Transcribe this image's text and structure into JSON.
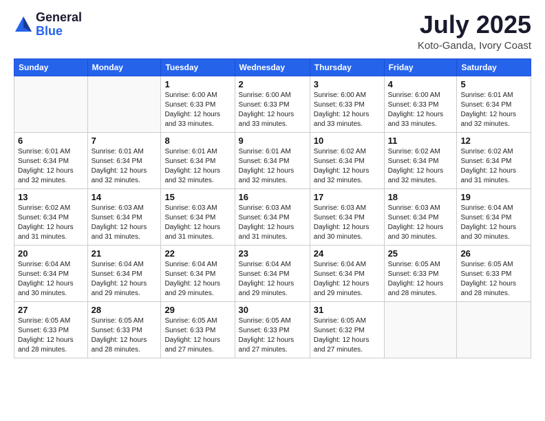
{
  "logo": {
    "general": "General",
    "blue": "Blue"
  },
  "title": "July 2025",
  "location": "Koto-Ganda, Ivory Coast",
  "days_of_week": [
    "Sunday",
    "Monday",
    "Tuesday",
    "Wednesday",
    "Thursday",
    "Friday",
    "Saturday"
  ],
  "weeks": [
    [
      {
        "num": "",
        "info": ""
      },
      {
        "num": "",
        "info": ""
      },
      {
        "num": "1",
        "info": "Sunrise: 6:00 AM\nSunset: 6:33 PM\nDaylight: 12 hours\nand 33 minutes."
      },
      {
        "num": "2",
        "info": "Sunrise: 6:00 AM\nSunset: 6:33 PM\nDaylight: 12 hours\nand 33 minutes."
      },
      {
        "num": "3",
        "info": "Sunrise: 6:00 AM\nSunset: 6:33 PM\nDaylight: 12 hours\nand 33 minutes."
      },
      {
        "num": "4",
        "info": "Sunrise: 6:00 AM\nSunset: 6:33 PM\nDaylight: 12 hours\nand 33 minutes."
      },
      {
        "num": "5",
        "info": "Sunrise: 6:01 AM\nSunset: 6:34 PM\nDaylight: 12 hours\nand 32 minutes."
      }
    ],
    [
      {
        "num": "6",
        "info": "Sunrise: 6:01 AM\nSunset: 6:34 PM\nDaylight: 12 hours\nand 32 minutes."
      },
      {
        "num": "7",
        "info": "Sunrise: 6:01 AM\nSunset: 6:34 PM\nDaylight: 12 hours\nand 32 minutes."
      },
      {
        "num": "8",
        "info": "Sunrise: 6:01 AM\nSunset: 6:34 PM\nDaylight: 12 hours\nand 32 minutes."
      },
      {
        "num": "9",
        "info": "Sunrise: 6:01 AM\nSunset: 6:34 PM\nDaylight: 12 hours\nand 32 minutes."
      },
      {
        "num": "10",
        "info": "Sunrise: 6:02 AM\nSunset: 6:34 PM\nDaylight: 12 hours\nand 32 minutes."
      },
      {
        "num": "11",
        "info": "Sunrise: 6:02 AM\nSunset: 6:34 PM\nDaylight: 12 hours\nand 32 minutes."
      },
      {
        "num": "12",
        "info": "Sunrise: 6:02 AM\nSunset: 6:34 PM\nDaylight: 12 hours\nand 31 minutes."
      }
    ],
    [
      {
        "num": "13",
        "info": "Sunrise: 6:02 AM\nSunset: 6:34 PM\nDaylight: 12 hours\nand 31 minutes."
      },
      {
        "num": "14",
        "info": "Sunrise: 6:03 AM\nSunset: 6:34 PM\nDaylight: 12 hours\nand 31 minutes."
      },
      {
        "num": "15",
        "info": "Sunrise: 6:03 AM\nSunset: 6:34 PM\nDaylight: 12 hours\nand 31 minutes."
      },
      {
        "num": "16",
        "info": "Sunrise: 6:03 AM\nSunset: 6:34 PM\nDaylight: 12 hours\nand 31 minutes."
      },
      {
        "num": "17",
        "info": "Sunrise: 6:03 AM\nSunset: 6:34 PM\nDaylight: 12 hours\nand 30 minutes."
      },
      {
        "num": "18",
        "info": "Sunrise: 6:03 AM\nSunset: 6:34 PM\nDaylight: 12 hours\nand 30 minutes."
      },
      {
        "num": "19",
        "info": "Sunrise: 6:04 AM\nSunset: 6:34 PM\nDaylight: 12 hours\nand 30 minutes."
      }
    ],
    [
      {
        "num": "20",
        "info": "Sunrise: 6:04 AM\nSunset: 6:34 PM\nDaylight: 12 hours\nand 30 minutes."
      },
      {
        "num": "21",
        "info": "Sunrise: 6:04 AM\nSunset: 6:34 PM\nDaylight: 12 hours\nand 29 minutes."
      },
      {
        "num": "22",
        "info": "Sunrise: 6:04 AM\nSunset: 6:34 PM\nDaylight: 12 hours\nand 29 minutes."
      },
      {
        "num": "23",
        "info": "Sunrise: 6:04 AM\nSunset: 6:34 PM\nDaylight: 12 hours\nand 29 minutes."
      },
      {
        "num": "24",
        "info": "Sunrise: 6:04 AM\nSunset: 6:34 PM\nDaylight: 12 hours\nand 29 minutes."
      },
      {
        "num": "25",
        "info": "Sunrise: 6:05 AM\nSunset: 6:33 PM\nDaylight: 12 hours\nand 28 minutes."
      },
      {
        "num": "26",
        "info": "Sunrise: 6:05 AM\nSunset: 6:33 PM\nDaylight: 12 hours\nand 28 minutes."
      }
    ],
    [
      {
        "num": "27",
        "info": "Sunrise: 6:05 AM\nSunset: 6:33 PM\nDaylight: 12 hours\nand 28 minutes."
      },
      {
        "num": "28",
        "info": "Sunrise: 6:05 AM\nSunset: 6:33 PM\nDaylight: 12 hours\nand 28 minutes."
      },
      {
        "num": "29",
        "info": "Sunrise: 6:05 AM\nSunset: 6:33 PM\nDaylight: 12 hours\nand 27 minutes."
      },
      {
        "num": "30",
        "info": "Sunrise: 6:05 AM\nSunset: 6:33 PM\nDaylight: 12 hours\nand 27 minutes."
      },
      {
        "num": "31",
        "info": "Sunrise: 6:05 AM\nSunset: 6:32 PM\nDaylight: 12 hours\nand 27 minutes."
      },
      {
        "num": "",
        "info": ""
      },
      {
        "num": "",
        "info": ""
      }
    ]
  ]
}
